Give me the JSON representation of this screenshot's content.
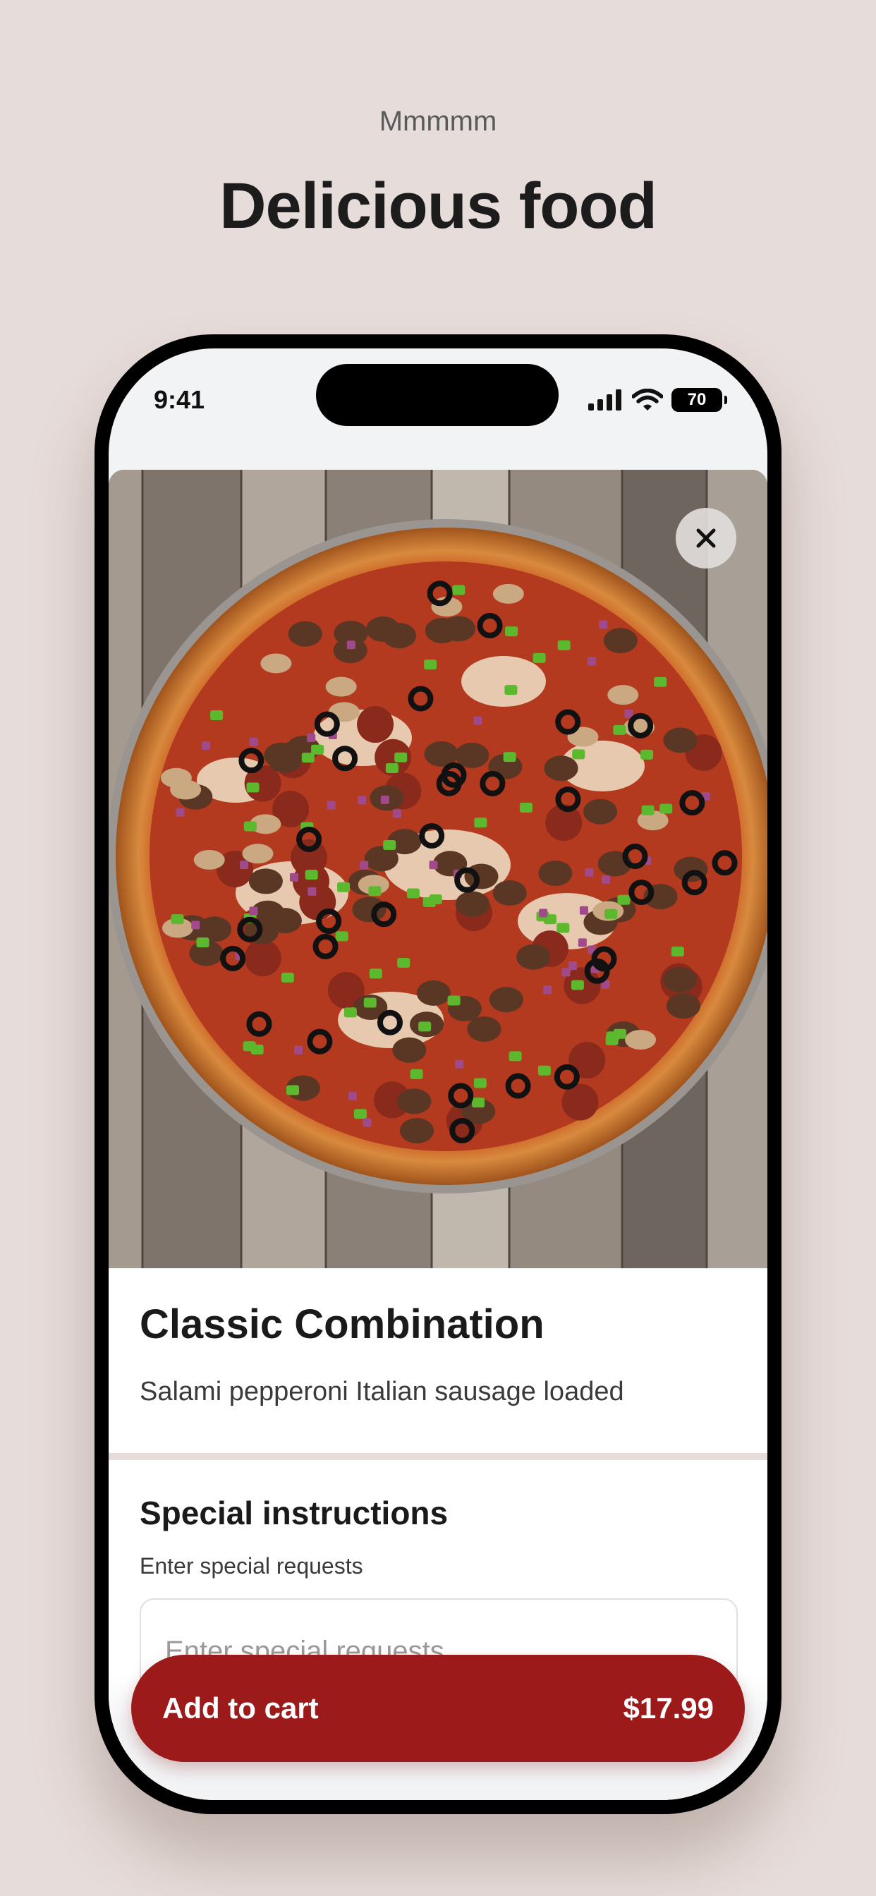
{
  "hero": {
    "eyebrow": "Mmmmm",
    "title": "Delicious food"
  },
  "status_bar": {
    "time": "9:41",
    "battery": "70",
    "icons": [
      "signal-icon",
      "wifi-icon",
      "battery-icon"
    ]
  },
  "item": {
    "image": "pizza-photo",
    "title": "Classic Combination",
    "description": "Salami pepperoni Italian sausage loaded"
  },
  "special_instructions": {
    "title": "Special instructions",
    "subtitle": "Enter special requests",
    "placeholder": "Enter special requests",
    "value": ""
  },
  "cart_button": {
    "label": "Add to cart",
    "price": "$17.99"
  },
  "colors": {
    "background": "#e6dcd9",
    "accent": "#9d1a1a",
    "divider": "#e6dcd9"
  }
}
